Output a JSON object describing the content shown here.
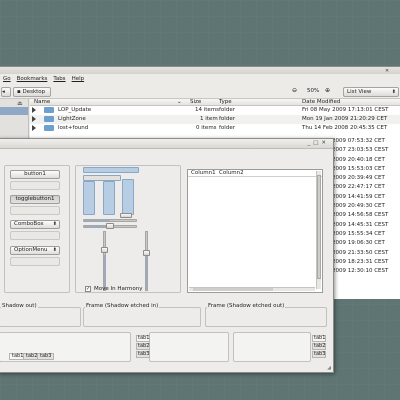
{
  "file_manager": {
    "menu": [
      "Go",
      "Bookmarks",
      "Tabs",
      "Help"
    ],
    "toolbar": {
      "desktop_label": "Desktop",
      "zoom_value": "50%",
      "view_mode": "List View"
    },
    "columns": [
      "Name",
      "Size",
      "Type",
      "Date Modified"
    ],
    "rows": [
      {
        "name": "LOP_Update",
        "size": "14 items",
        "type": "folder",
        "date": "Fri 08 May 2009 17:13:01 CEST"
      },
      {
        "name": "LightZone",
        "size": "1 item",
        "type": "folder",
        "date": "Mon 19 Jan 2009 21:20:29 CET"
      },
      {
        "name": "lost+found",
        "size": "0 items",
        "type": "folder",
        "date": "Thu 14 Feb 2008 20:45:35 CET"
      }
    ],
    "date_fragments": [
      "2009 07:53:32 CET",
      "2007 23:03:53 CEST",
      "2009 20:40:18 CET",
      "2009 15:53:03 CET",
      "2009 20:39:49 CET",
      "2009 22:47:17 CET",
      "2009 14:41:59 CET",
      "2009 20:49:30 CET",
      "2009 14:56:58 CEST",
      "2009 14:45:31 CEST",
      "2009 15:55:34 CET",
      "2009 19:06:30 CET",
      "2009 21:33:50 CEST",
      "2009 18:23:31 CEST",
      "2009 12:30:10 CEST"
    ]
  },
  "demo": {
    "buttons": {
      "button1": "button1",
      "togglebutton1": "togglebutton1",
      "combobox": "ComboBox",
      "optionmenu": "OptionMenu"
    },
    "checkbox_label": "Move In Harmony",
    "checkbox_checked": true,
    "tree_columns": [
      "Column1",
      "Column2"
    ],
    "frames": [
      "Shadow out)",
      "Frame (Shadow etched in)",
      "Frame (Shadow etched out)"
    ],
    "tabs_bottom": [
      "tab1",
      "tab2",
      "tab3"
    ],
    "tabs_side": [
      "tab1",
      "tab2",
      "tab3"
    ],
    "tabs_right": [
      "tab1",
      "tab2",
      "tab3"
    ],
    "hscale_value": 0.5,
    "vscale_value": 0.6
  }
}
